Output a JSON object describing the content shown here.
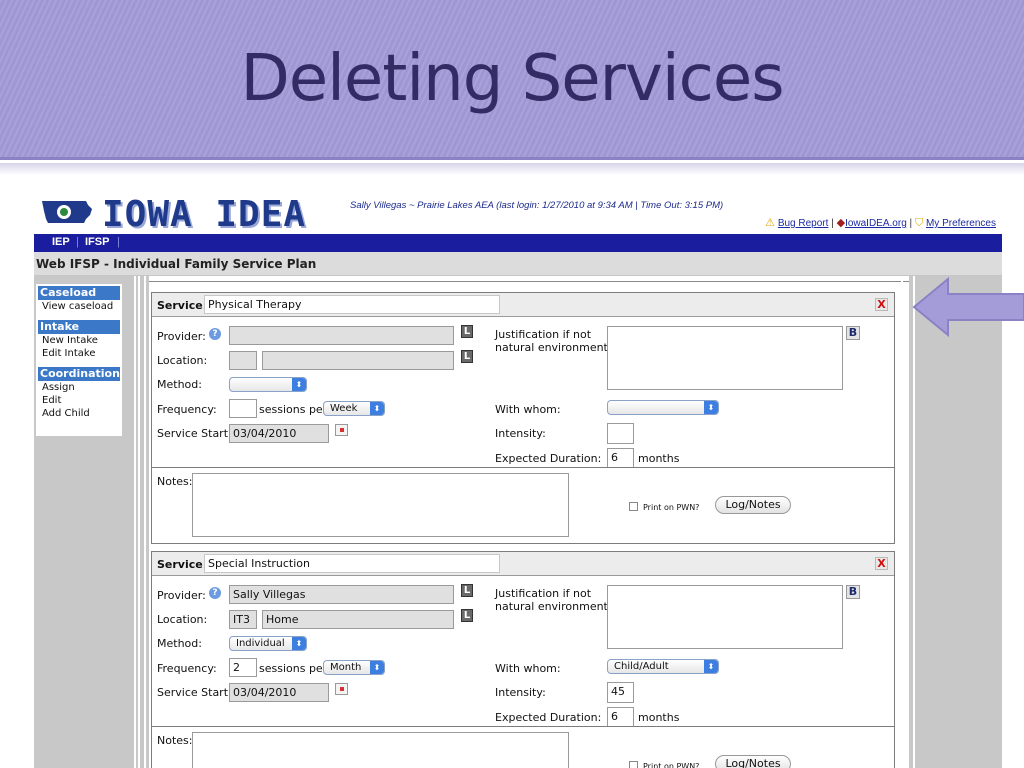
{
  "slide": {
    "title": "Deleting Services"
  },
  "app": {
    "logo_text": "IOWA IDEA",
    "user_info": "Sally Villegas ~ Prairie Lakes AEA  (last login: 1/27/2010 at 9:34 AM  |  Time Out: 3:15 PM)",
    "links": {
      "bug_report": "Bug Report",
      "iowaidea": "IowaIDEA.org",
      "preferences": "My Preferences",
      "sep": "|"
    },
    "nav": [
      "IEP",
      "IFSP"
    ],
    "page_heading": "Web IFSP - Individual Family Service Plan"
  },
  "sidebar": {
    "sections": [
      {
        "header": "Caseload",
        "items": [
          "View caseload"
        ]
      },
      {
        "header": "Intake",
        "items": [
          "New Intake",
          "Edit Intake"
        ]
      },
      {
        "header": "Coordination",
        "items": [
          "Assign",
          "Edit",
          "Add Child"
        ]
      }
    ]
  },
  "labels": {
    "service": "Service:",
    "provider": "Provider:",
    "location": "Location:",
    "method": "Method:",
    "frequency": "Frequency:",
    "sessions_per": "sessions per",
    "service_start": "Service Start:",
    "justification_1": "Justification if not",
    "justification_2": "natural environment:",
    "with_whom": "With whom:",
    "intensity": "Intensity:",
    "expected_duration": "Expected Duration:",
    "months": "months",
    "notes": "Notes:",
    "print_on_pwn": "Print on PWN?",
    "log_notes": "Log/Notes",
    "delete": "X",
    "lookup": "L",
    "b": "B",
    "help": "?"
  },
  "services": [
    {
      "name": "Physical Therapy",
      "provider": "",
      "location_code": "",
      "location": "",
      "method": "",
      "frequency": "",
      "per": "Week",
      "service_start": "03/04/2010",
      "with_whom": "",
      "intensity": "",
      "duration": "6"
    },
    {
      "name": "Special Instruction",
      "provider": "Sally Villegas",
      "location_code": "IT3",
      "location": "Home",
      "method": "Individual",
      "frequency": "2",
      "per": "Month",
      "service_start": "03/04/2010",
      "with_whom": "Child/Adult",
      "intensity": "45",
      "duration": "6"
    }
  ],
  "colors": {
    "slide_header": "#a49cd8",
    "title": "#322b64",
    "nav": "#1a1d9e",
    "sidebar_head": "#3b78c8",
    "arrow": "#a49cd8"
  }
}
